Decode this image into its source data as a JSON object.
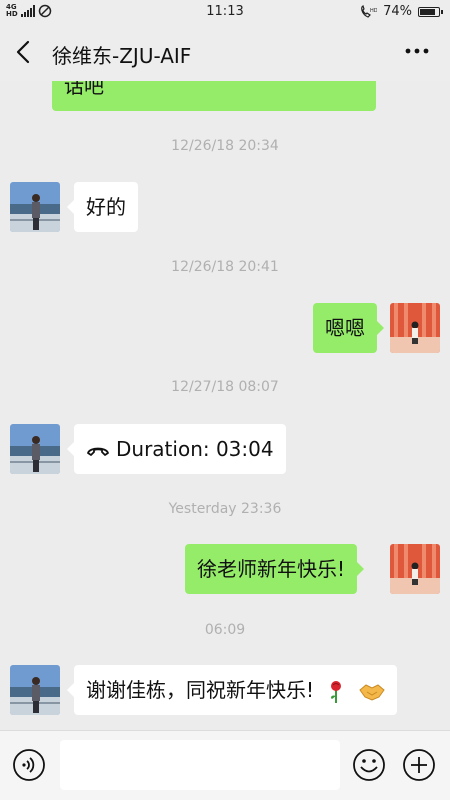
{
  "status_bar": {
    "network_top": "4G",
    "network_bottom": "HD",
    "time": "11:13",
    "battery": "74%",
    "battery_level": 0.74
  },
  "header": {
    "title": "徐维东-ZJU-AIF"
  },
  "messages": [
    {
      "type": "outgoing",
      "text": "话吧"
    },
    {
      "type": "timestamp",
      "text": "12/26/18 20:34"
    },
    {
      "type": "incoming",
      "text": "好的"
    },
    {
      "type": "timestamp",
      "text": "12/26/18 20:41"
    },
    {
      "type": "outgoing",
      "text": "嗯嗯"
    },
    {
      "type": "timestamp",
      "text": "12/27/18 08:07"
    },
    {
      "type": "incoming_call",
      "text": "Duration: 03:04",
      "icon": "phone-hangup-icon"
    },
    {
      "type": "timestamp",
      "text": "Yesterday 23:36"
    },
    {
      "type": "outgoing",
      "text": "徐老师新年快乐!"
    },
    {
      "type": "timestamp",
      "text": "06:09"
    },
    {
      "type": "incoming",
      "text": "谢谢佳栋，同祝新年快乐!",
      "emojis": [
        "rose-icon",
        "handshake-icon"
      ]
    }
  ],
  "input_bar": {
    "value": "",
    "placeholder": ""
  },
  "colors": {
    "background": "#ececec",
    "outgoing_bubble": "#95ec69",
    "incoming_bubble": "#ffffff",
    "timestamp": "#b0b0b0"
  }
}
